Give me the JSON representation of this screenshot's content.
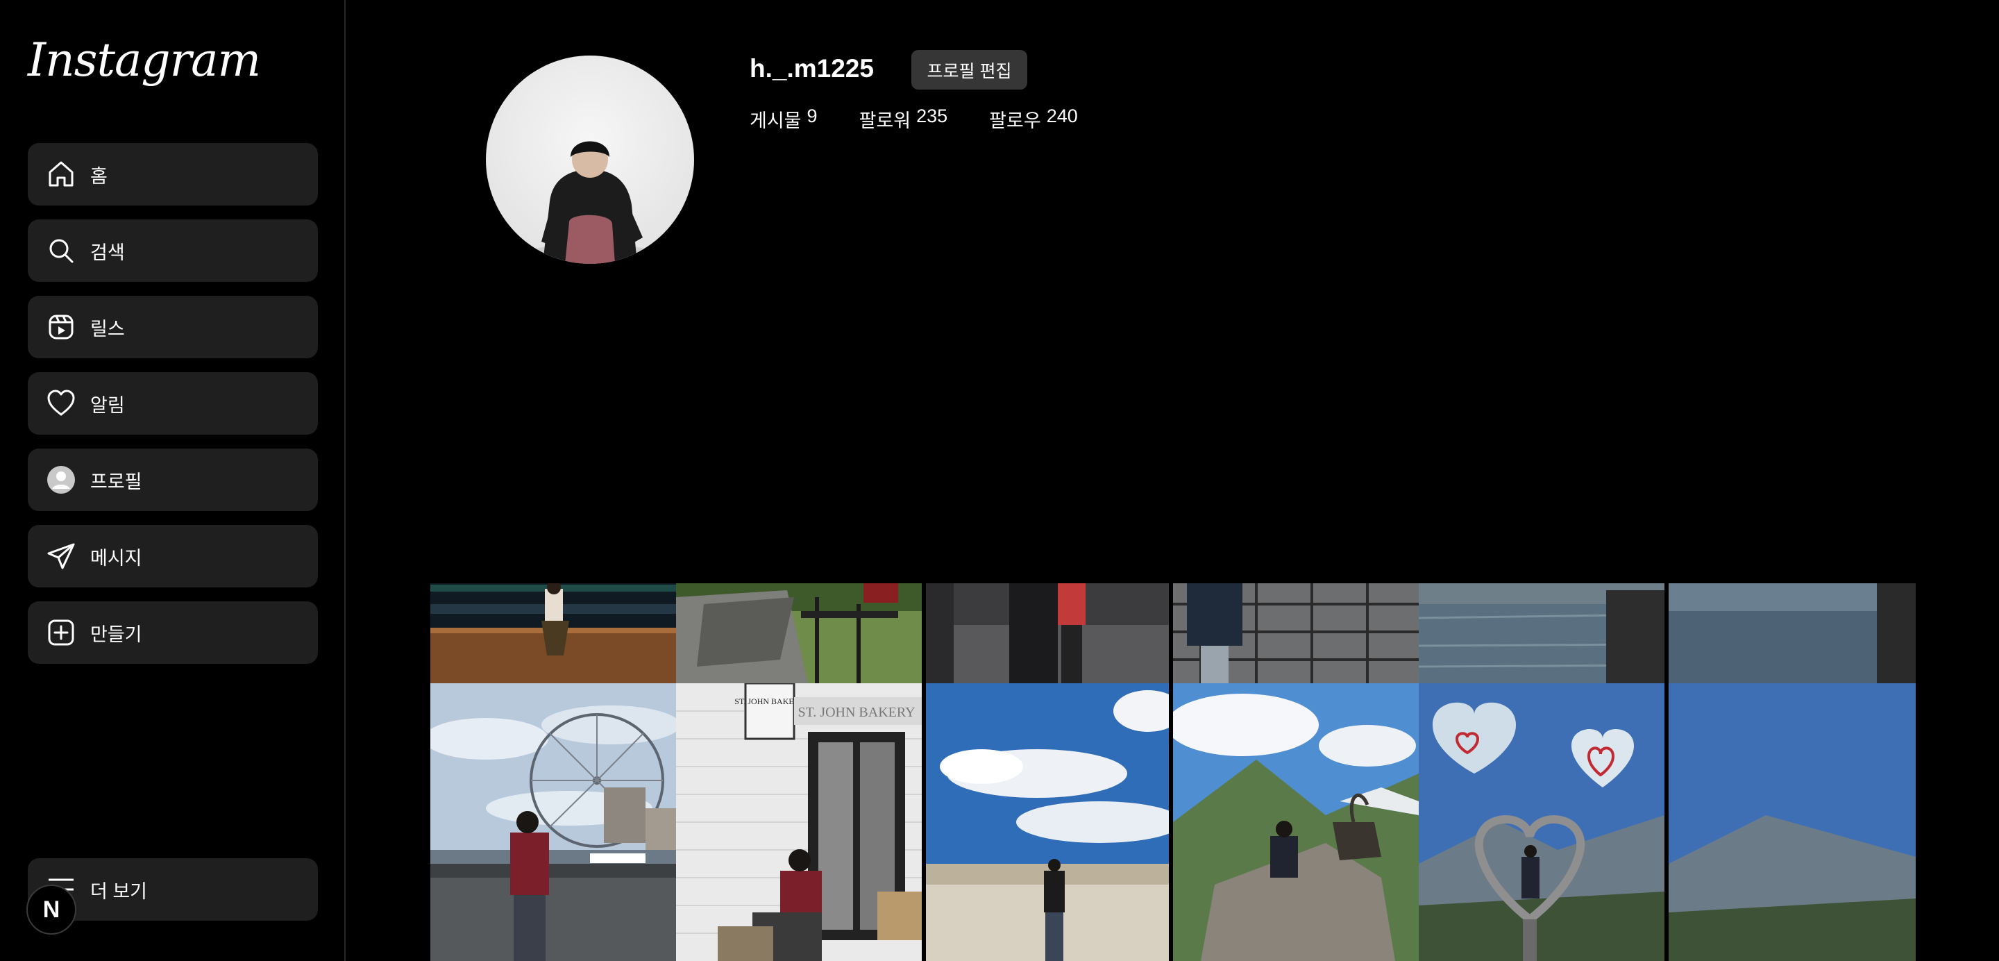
{
  "app": {
    "logo_text": "Instagram"
  },
  "sidebar": {
    "items": [
      {
        "label": "홈",
        "icon": "home-icon"
      },
      {
        "label": "검색",
        "icon": "search-icon"
      },
      {
        "label": "릴스",
        "icon": "reels-icon"
      },
      {
        "label": "알림",
        "icon": "heart-icon"
      },
      {
        "label": "프로필",
        "icon": "profile-avatar-icon"
      },
      {
        "label": "메시지",
        "icon": "paper-plane-icon"
      },
      {
        "label": "만들기",
        "icon": "plus-square-icon"
      }
    ],
    "more": {
      "label": "더 보기",
      "icon": "menu-icon"
    },
    "badge": "N"
  },
  "profile": {
    "username": "h._.m1225",
    "edit_button": "프로필 편집",
    "stats": {
      "posts_label": "게시물",
      "posts": "9",
      "followers_label": "팔로워",
      "followers": "235",
      "following_label": "팔로우",
      "following": "240"
    }
  },
  "posts": [
    {
      "scene": "person-sitting-on-riverside-wall"
    },
    {
      "scene": "legs-on-park-bench"
    },
    {
      "scene": "people-on-cobblestone-street"
    },
    {
      "scene": "person-walking-on-plaza"
    },
    {
      "scene": "person-at-railing"
    },
    {
      "scene": "lake-view"
    },
    {
      "scene": "london-eye-riverside"
    },
    {
      "scene": "st-john-bakery-storefront"
    },
    {
      "scene": "blue-sky-with-clouds"
    },
    {
      "scene": "louvre-pyramid"
    },
    {
      "scene": "mountain-ibex"
    },
    {
      "scene": "heart-frame-mountains"
    }
  ],
  "photo_text": {
    "bakery_sign": "ST. JOHN BAKERY",
    "bakery_storefront": "ST. JOHN BAKERY"
  },
  "colors": {
    "background": "#000000",
    "nav_item": "#1f1f1f",
    "button": "#363636",
    "divider": "#262626"
  }
}
